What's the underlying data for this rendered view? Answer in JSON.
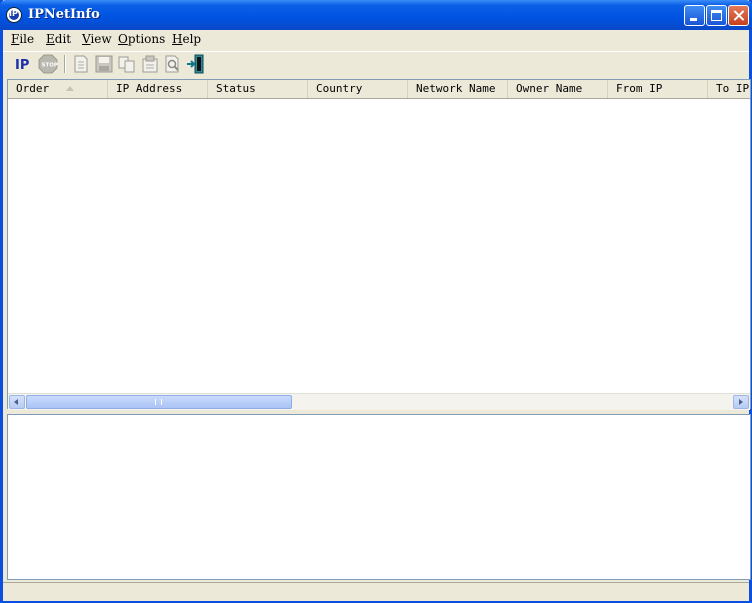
{
  "window": {
    "title": "IPNetInfo"
  },
  "menu": [
    {
      "letter": "F",
      "rest": "ile"
    },
    {
      "letter": "E",
      "rest": "dit"
    },
    {
      "letter": "V",
      "rest": "iew"
    },
    {
      "letter": "O",
      "rest": "ptions"
    },
    {
      "letter": "H",
      "rest": "elp"
    }
  ],
  "toolbar": {
    "items": [
      "ip-lookup-icon",
      "stop-icon",
      "html-report-icon",
      "save-icon",
      "copy-icon",
      "properties-icon",
      "find-icon",
      "exit-icon"
    ]
  },
  "table": {
    "columns": [
      "Order",
      "IP Address",
      "Status",
      "Country",
      "Network Name",
      "Owner Name",
      "From IP",
      "To IP"
    ],
    "sorted_column": "Order",
    "rows": []
  },
  "colors": {
    "title_bar": "#0053e1",
    "window_bg": "#ece9d8",
    "border": "#7f9db9"
  }
}
